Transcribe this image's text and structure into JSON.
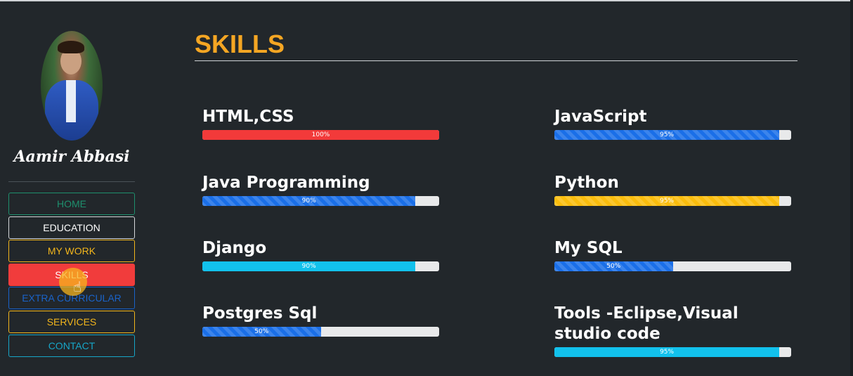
{
  "profile": {
    "name": "Aamir Abbasi"
  },
  "nav": [
    {
      "label": "HOME"
    },
    {
      "label": "EDUCATION"
    },
    {
      "label": "MY WORK"
    },
    {
      "label": "SKILLS"
    },
    {
      "label": "EXTRA CURRICULAR"
    },
    {
      "label": "SERVICES"
    },
    {
      "label": "CONTACT"
    }
  ],
  "section": {
    "title": "SKILLS"
  },
  "skills": [
    {
      "name": "HTML,CSS",
      "percent_label": "100%",
      "value": 100,
      "color": "#f23a3a"
    },
    {
      "name": "JavaScript",
      "percent_label": "95%",
      "value": 95,
      "color": "#1a6fe8"
    },
    {
      "name": "Java Programming",
      "percent_label": "90%",
      "value": 90,
      "color": "#1a6fe8"
    },
    {
      "name": "Python",
      "percent_label": "95%",
      "value": 95,
      "color": "#fbbd0c"
    },
    {
      "name": "Django",
      "percent_label": "90%",
      "value": 90,
      "color": "#12c1ec"
    },
    {
      "name": "My SQL",
      "percent_label": "50%",
      "value": 50,
      "color": "#1a6fe8"
    },
    {
      "name": "Postgres Sql",
      "percent_label": "50%",
      "value": 50,
      "color": "#1a6fe8"
    },
    {
      "name": "Tools -Eclipse,Visual studio code",
      "percent_label": "95%",
      "value": 95,
      "color": "#12c1ec"
    }
  ],
  "icons": {
    "cursor": "pointer-hand-icon"
  }
}
